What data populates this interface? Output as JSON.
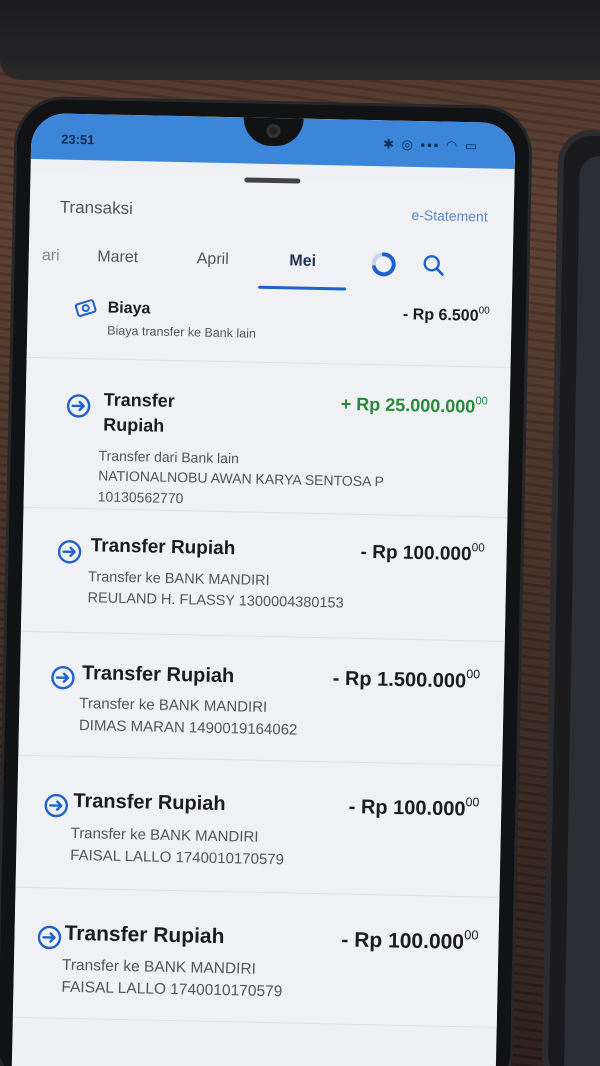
{
  "status_bar": {
    "time": "23:51",
    "icons_text": "✱ ◎ ▪▪▪ ◠ ▭"
  },
  "header": {
    "title": "Transaksi",
    "estatement_label": "e-Statement"
  },
  "tabs": [
    "ari",
    "Maret",
    "April",
    "Mei"
  ],
  "active_tab": "Mei",
  "transactions": [
    {
      "name": "Biaya",
      "amount": "- Rp 6.500",
      "cents": "00",
      "type": "debit",
      "icon": "fee-icon",
      "lines": [
        "Biaya transfer ke Bank lain"
      ]
    },
    {
      "name": "Transfer Rupiah",
      "amount": "+ Rp 25.000.000",
      "cents": "00",
      "type": "credit",
      "icon": "transfer-icon",
      "lines": [
        "Transfer dari Bank lain",
        "NATIONALNOBU AWAN KARYA SENTOSA P",
        "10130562770"
      ]
    },
    {
      "name": "Transfer Rupiah",
      "amount": "- Rp 100.000",
      "cents": "00",
      "type": "debit",
      "icon": "transfer-icon",
      "lines": [
        "Transfer ke BANK MANDIRI",
        "REULAND H. FLASSY 1300004380153"
      ]
    },
    {
      "name": "Transfer Rupiah",
      "amount": "- Rp 1.500.000",
      "cents": "00",
      "type": "debit",
      "icon": "transfer-icon",
      "lines": [
        "Transfer ke BANK MANDIRI",
        "DIMAS MARAN 1490019164062"
      ]
    },
    {
      "name": "Transfer Rupiah",
      "amount": "- Rp 100.000",
      "cents": "00",
      "type": "debit",
      "icon": "transfer-icon",
      "lines": [
        "Transfer ke BANK MANDIRI",
        "FAISAL LALLO 1740010170579"
      ]
    },
    {
      "name": "Transfer Rupiah",
      "amount": "- Rp 100.000",
      "cents": "00",
      "type": "debit",
      "icon": "transfer-icon",
      "lines": [
        "Transfer ke BANK MANDIRI",
        "FAISAL LALLO 1740010170579"
      ]
    }
  ],
  "colors": {
    "accent": "#1f62c9",
    "credit": "#2a8a3b",
    "statusbar": "#3b86d8"
  }
}
